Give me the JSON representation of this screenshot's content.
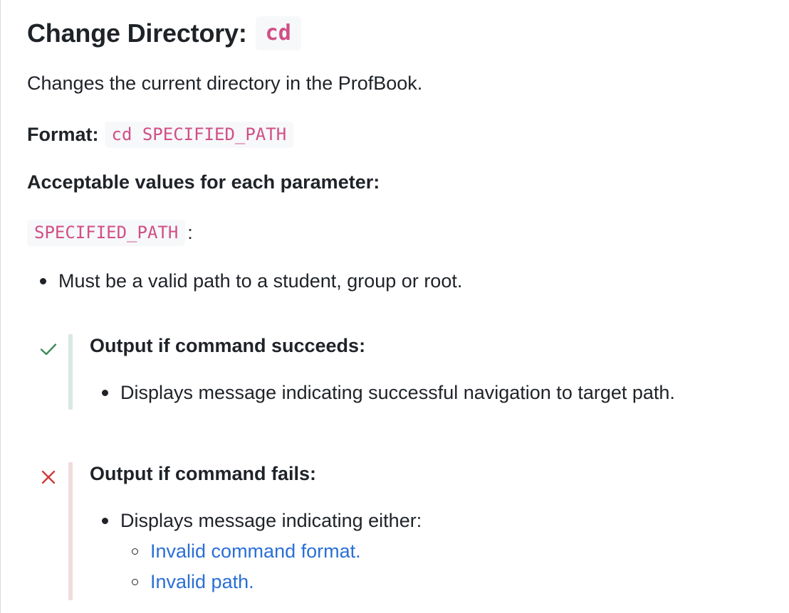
{
  "heading": {
    "text": "Change Directory:",
    "code": "cd"
  },
  "description": "Changes the current directory in the ProfBook.",
  "format": {
    "label": "Format:",
    "code": "cd SPECIFIED_PATH"
  },
  "parameters": {
    "title": "Acceptable values for each parameter:",
    "items": [
      {
        "name": "SPECIFIED_PATH",
        "separator": ":",
        "rules": [
          "Must be a valid path to a student, group or root."
        ]
      }
    ]
  },
  "callouts": {
    "success": {
      "icon": "check-icon",
      "color": "#3f8a5a",
      "title": "Output if command succeeds:",
      "bullets": [
        "Displays message indicating successful navigation to target path."
      ]
    },
    "failure": {
      "icon": "cross-icon",
      "color": "#cf3b3b",
      "title": "Output if command fails:",
      "bullets": [
        "Displays message indicating either:"
      ],
      "sub_bullets": [
        "Invalid command format.",
        "Invalid path."
      ]
    }
  },
  "colors": {
    "code_text": "#d14f86",
    "code_background": "#f6f8fa",
    "link": "#2a6fd6",
    "success_bar": "#dae8e2",
    "failure_bar": "#f3dcdc"
  }
}
